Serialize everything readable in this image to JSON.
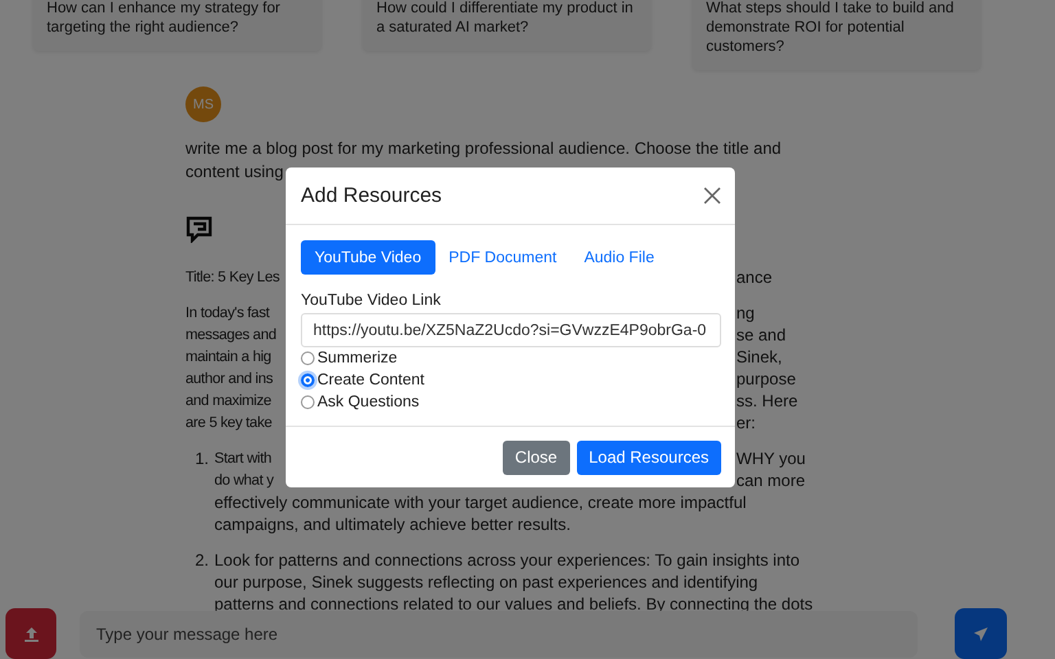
{
  "suggestions": [
    {
      "text": "How can I enhance my strategy for targeting the right audience?"
    },
    {
      "text": "How could I differentiate my product in a saturated AI market?"
    },
    {
      "text": "What steps should I take to build and demonstrate ROI for potential customers?"
    }
  ],
  "user_message": {
    "initials": "MS",
    "lines": [
      {
        "kind": "full",
        "text": "write me a blog post for my marketing professional audience. Choose the title and"
      },
      {
        "kind": "full",
        "text": "content using"
      }
    ]
  },
  "reply": {
    "title_line": {
      "kind": "split",
      "left": "Title: 5 Key Les",
      "right": "ance"
    },
    "paragraph": [
      {
        "kind": "split",
        "left": "In today's fast",
        "right": "ng"
      },
      {
        "kind": "split",
        "left": "messages and",
        "right": "se and"
      },
      {
        "kind": "split",
        "left": "maintain a hig",
        "right": "Sinek,"
      },
      {
        "kind": "split",
        "left": "author and ins",
        "right": "purpose"
      },
      {
        "kind": "split",
        "left": "and maximize",
        "right": "ss. Here"
      },
      {
        "kind": "split",
        "left": "are 5 key take",
        "right": "er:"
      }
    ],
    "list": [
      {
        "marker": "1.",
        "lines": [
          {
            "kind": "split",
            "left": "Start with",
            "right": "WHY you"
          },
          {
            "kind": "split",
            "left": "do what y",
            "right": "can more"
          },
          {
            "kind": "full",
            "text": "effectively communicate with your target audience, create more impactful"
          },
          {
            "kind": "full",
            "text": "campaigns, and ultimately achieve better results."
          }
        ]
      },
      {
        "marker": "2.",
        "lines": [
          {
            "kind": "full",
            "text": "Look for patterns and connections across your experiences: To gain insights into"
          },
          {
            "kind": "full",
            "text": "our purpose, Sinek suggests reflecting on past experiences and identifying"
          },
          {
            "kind": "full",
            "text": "patterns and connections related to our values and beliefs. By connecting the dots"
          }
        ]
      }
    ]
  },
  "composer": {
    "placeholder": "Type your message here"
  },
  "modal": {
    "title": "Add Resources",
    "tabs": [
      {
        "label": "YouTube Video",
        "selected": true
      },
      {
        "label": "PDF Document",
        "selected": false
      },
      {
        "label": "Audio File",
        "selected": false
      }
    ],
    "link_label": "YouTube Video Link",
    "link_value": "https://youtu.be/XZ5NaZ2Ucdo?si=GVwzzE4P9obrGa-0",
    "options": [
      {
        "label": "Summerize",
        "selected": false
      },
      {
        "label": "Create Content",
        "selected": true
      },
      {
        "label": "Ask Questions",
        "selected": false
      }
    ],
    "buttons": [
      {
        "label": "Close",
        "kind": "secondary"
      },
      {
        "label": "Load Resources",
        "kind": "primary"
      }
    ]
  }
}
